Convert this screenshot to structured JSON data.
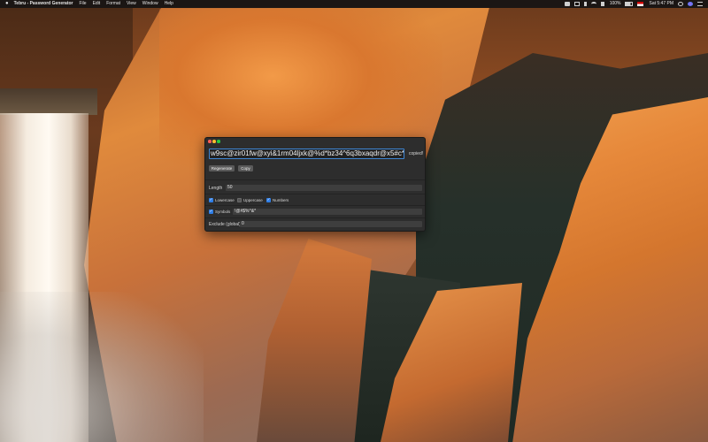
{
  "menubar": {
    "apple_icon": "apple-logo",
    "app_name": "Tebru - Password Generator",
    "menus": [
      "File",
      "Edit",
      "Format",
      "View",
      "Window",
      "Help"
    ],
    "battery": "100%",
    "clock": "Sat 5:47 PM"
  },
  "window": {
    "password": "w9sc@zir01fw@xyi&1rm04ljxk@%d*bz34^6q3bxaqdr@x5#c*",
    "copied_label": "copied!",
    "regenerate_label": "Regenerate",
    "copy_label": "Copy",
    "length_label": "Length",
    "length_value": "50",
    "lowercase_label": "Lowercase",
    "uppercase_label": "Uppercase",
    "numbers_label": "Numbers",
    "symbols_label": "Symbols",
    "symbols_value": "!@#$%^&*",
    "exclude_label": "Exclude (global)",
    "exclude_value": "0",
    "lowercase_checked": true,
    "uppercase_checked": false,
    "numbers_checked": true,
    "symbols_checked": true
  },
  "colors": {
    "accent": "#3f86d4",
    "checkbox_on": "#2f7ee6",
    "window_bg": "#2d2d2d"
  }
}
